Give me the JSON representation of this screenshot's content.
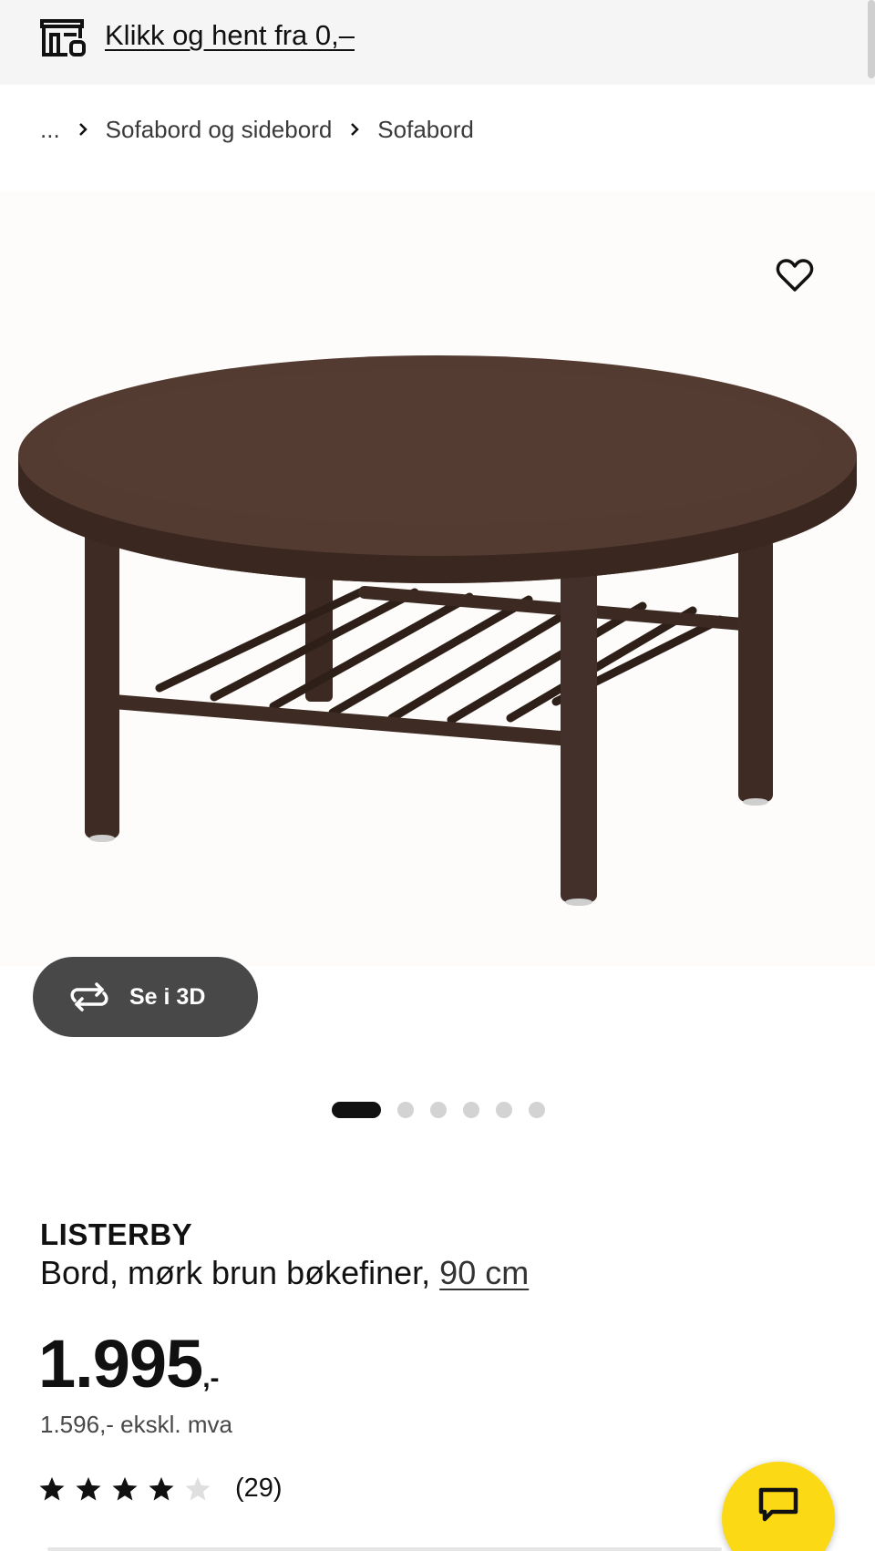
{
  "promo": {
    "icon": "store-pickup-icon",
    "link_text": "Klikk og hent fra 0,–"
  },
  "breadcrumb": {
    "ellipsis": "...",
    "items": [
      "Sofabord og sidebord",
      "Sofabord"
    ]
  },
  "gallery": {
    "image_description": "round coffee table",
    "favourite_icon": "heart-icon",
    "view_3d_icon": "rotate-3d-icon",
    "view_3d_label": "Se i 3D",
    "image_count": 6,
    "active_index": 0
  },
  "product": {
    "name": "LISTERBY",
    "description": "Bord, mørk brun bøkefiner,",
    "size_link": "90 cm",
    "price_main": "1.995",
    "price_suffix": ",-",
    "price_ex_vat": "1.596,- ekskl. mva",
    "rating": 4,
    "rating_max": 5,
    "review_count": "(29)"
  },
  "chat": {
    "icon": "chat-bubble-icon"
  },
  "colors": {
    "chat_yellow": "#fbd914",
    "button_3d_bg": "#484848",
    "wood_dark": "#4a352c",
    "star_filled": "#111111",
    "star_empty": "#dfdfdf"
  }
}
